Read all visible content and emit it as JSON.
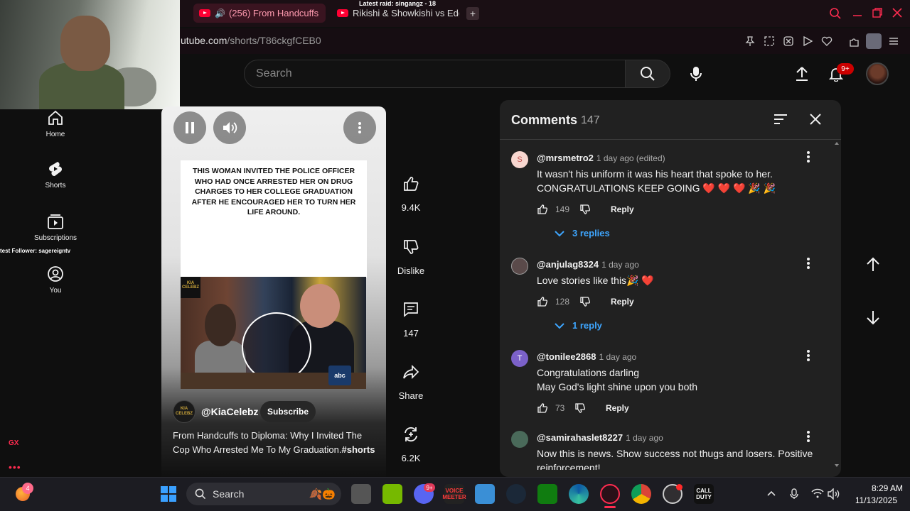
{
  "browser": {
    "raid_banner": "Latest raid: singangz - 18",
    "tabs": [
      {
        "label": "(256) From Handcuffs",
        "active": true
      },
      {
        "label": "Rikishi & Showkishi vs Edg",
        "active": false
      }
    ],
    "url_domain": "utube.com",
    "url_path": "/shorts/T86ckgfCEB0"
  },
  "header": {
    "search_placeholder": "Search",
    "notifications_badge": "9+"
  },
  "sidebar": {
    "items": [
      {
        "label": "Home",
        "icon": "home-icon"
      },
      {
        "label": "Shorts",
        "icon": "shorts-icon"
      },
      {
        "label": "Subscriptions",
        "icon": "subscriptions-icon"
      },
      {
        "label": "You",
        "icon": "account-icon"
      }
    ],
    "follower_overlay": "test Follower: sagereigntv",
    "gx_label": "GX",
    "more_label": "•••"
  },
  "short": {
    "headline": "THIS WOMAN INVITED THE POLICE OFFICER WHO HAD ONCE ARRESTED HER ON DRUG CHARGES TO HER COLLEGE GRADUATION AFTER HE ENCOURAGED HER TO TURN HER LIFE AROUND.",
    "photo_logo": "KIA CELEBZ",
    "network_logo": "abc",
    "channel_avatar_text": "KIA CELEBZ",
    "channel": "@KiaCelebz",
    "subscribe_label": "Subscribe",
    "title_text": "From Handcuffs to Diploma: Why I Invited The Cop Who Arrested Me To My Graduation.",
    "title_tag": "#shorts"
  },
  "actions": {
    "likes": "9.4K",
    "dislike_label": "Dislike",
    "comments": "147",
    "share_label": "Share",
    "remix": "6.2K"
  },
  "comments": {
    "title": "Comments",
    "count": "147",
    "reply_label": "Reply",
    "items": [
      {
        "avatar": "S",
        "avatar_color": "#f8d7d0",
        "handle": "@mrsmetro2",
        "time": "1 day ago (edited)",
        "lines": [
          "It wasn't  his uniform it was his heart that spoke to her.",
          "CONGRATULATIONS KEEP GOING ❤️ ❤️ ❤️ 🎉 🎉"
        ],
        "likes": "149",
        "replies": "3 replies"
      },
      {
        "avatar": "",
        "avatar_color": "#5a4a4a",
        "handle": "@anjulag8324",
        "time": "1 day ago",
        "lines": [
          "Love stories like this🎉 ❤️"
        ],
        "likes": "128",
        "replies": "1 reply"
      },
      {
        "avatar": "T",
        "avatar_color": "#7b61c9",
        "handle": "@tonilee2868",
        "time": "1 day ago",
        "lines": [
          "Congratulations darling",
          "May God's light shine upon you both"
        ],
        "likes": "73",
        "replies": ""
      },
      {
        "avatar": "",
        "avatar_color": "#4a6a5a",
        "handle": "@samirahaslet8227",
        "time": "1 day ago",
        "lines": [
          "Now this is news. Show success not thugs and losers. Positive",
          "reinforcement!"
        ],
        "likes": "",
        "replies": ""
      }
    ]
  },
  "taskbar": {
    "app_badge": "4",
    "search_label": "Search",
    "discord_badge": "9+",
    "voicemeeter_label": "VOICE MEETER",
    "cod_label": "CALL DUTY",
    "time": "8:29 AM",
    "date": "11/13/2025"
  },
  "colors": {
    "accent_red": "#ff0033",
    "link_blue": "#3ea6ff",
    "opera_red": "#ff2c50"
  }
}
